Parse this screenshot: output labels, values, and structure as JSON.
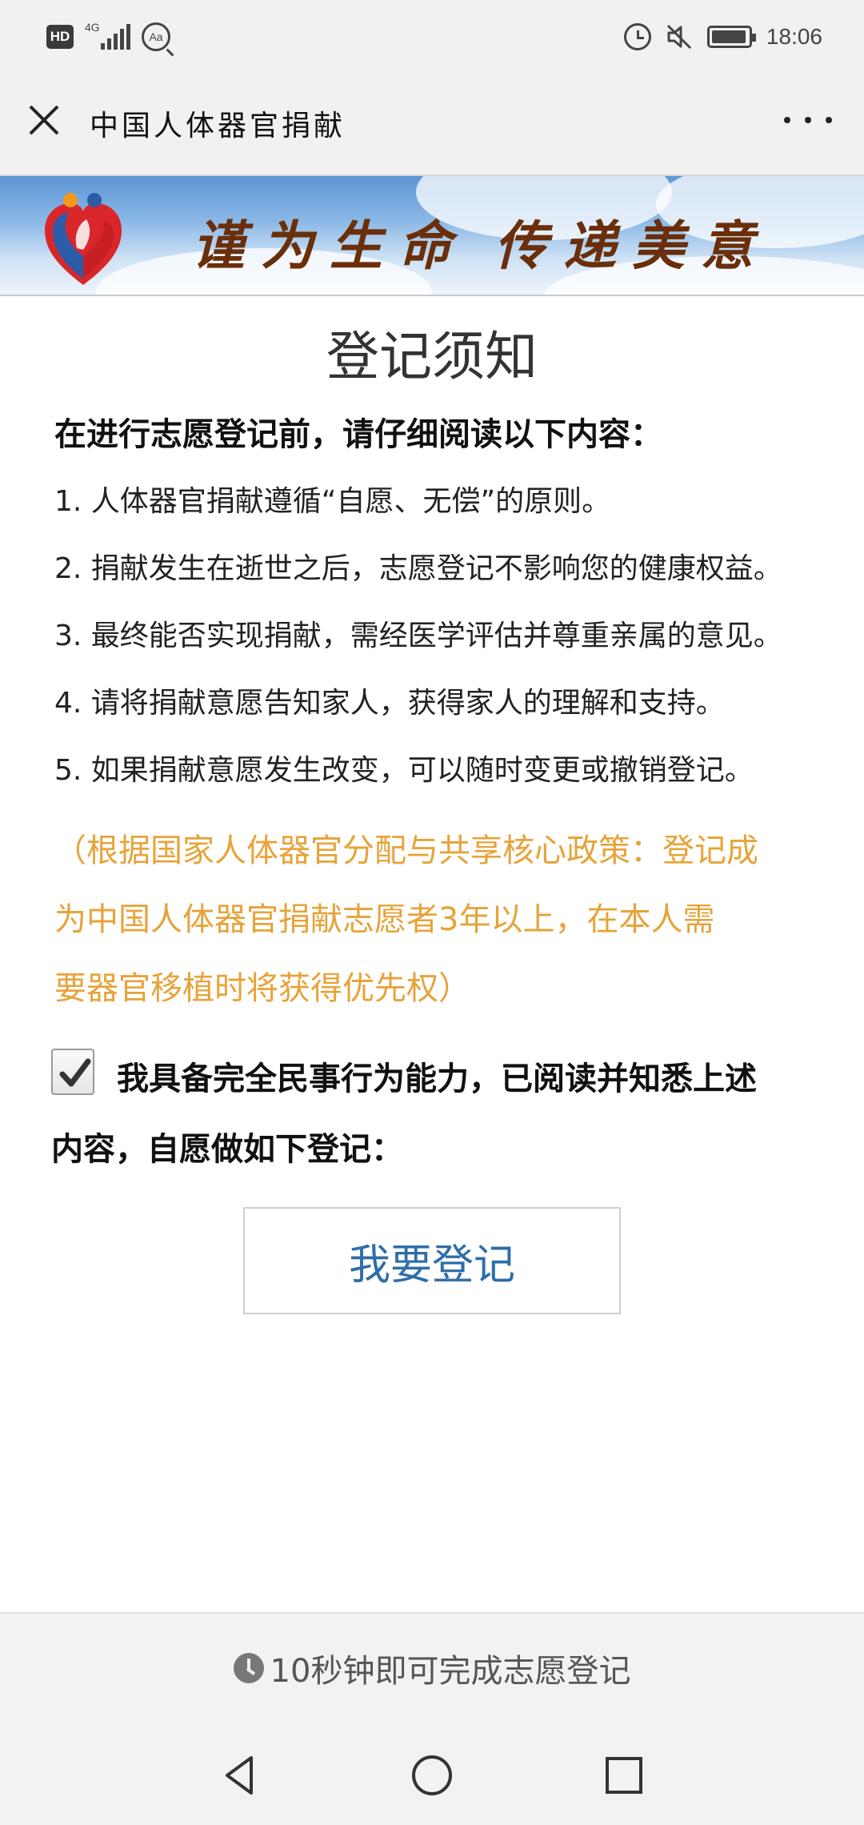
{
  "status_bar": {
    "hd": "HD",
    "network": "4G",
    "time": "18:06",
    "battery_level": 0.95,
    "icons": [
      "hd-badge",
      "signal-icon",
      "font-size-search-icon",
      "alarm-icon",
      "mute-icon",
      "battery-icon"
    ]
  },
  "title_bar": {
    "title": "中国人体器官捐献",
    "icons": [
      "close-icon",
      "more-icon"
    ]
  },
  "banner": {
    "slogan_left": "谨为生命",
    "slogan_right": "传递美意",
    "colors": {
      "sky": "#5c96d6",
      "slogan": "#6a2f0a",
      "logo_red": "#d9262b",
      "logo_blue": "#2a5ca8",
      "logo_orange": "#f29a1d"
    }
  },
  "notice": {
    "heading": "登记须知",
    "intro": "在进行志愿登记前，请仔细阅读以下内容：",
    "items": [
      "1. 人体器官捐献遵循“自愿、无偿”的原则。",
      "2. 捐献发生在逝世之后，志愿登记不影响您的健康权益。",
      "3. 最终能否实现捐献，需经医学评估并尊重亲属的意见。",
      "4. 请将捐献意愿告知家人，获得家人的理解和支持。",
      "5. 如果捐献意愿发生改变，可以随时变更或撤销登记。"
    ],
    "policy_lines": [
      "（根据国家人体器官分配与共享核心政策：登记成",
      "为中国人体器官捐献志愿者3年以上，在本人需",
      "要器官移植时将获得优先权）"
    ],
    "policy_color": "#e7a33a"
  },
  "consent": {
    "checked": true,
    "lines": [
      "我具备完全民事行为能力，已阅读并知悉上述",
      "内容，自愿做如下登记："
    ]
  },
  "register_button": {
    "label": "我要登记",
    "color": "#2e6ea8"
  },
  "footer": {
    "text": "10秒钟即可完成志愿登记",
    "icon": "clock-icon"
  },
  "nav_bar": {
    "icons": [
      "back-icon",
      "home-icon",
      "recents-icon"
    ]
  }
}
